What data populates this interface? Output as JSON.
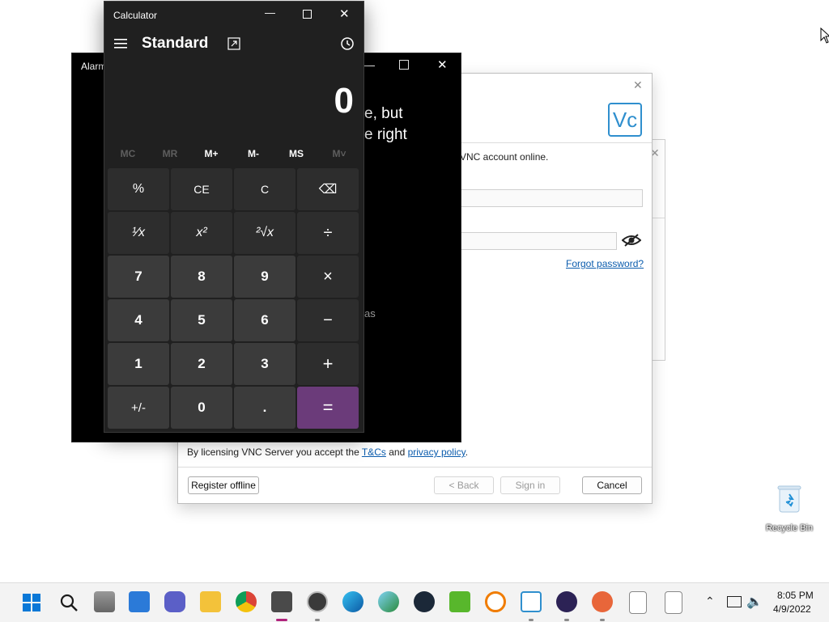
{
  "desktop": {
    "recycle_bin_label": "Recycle Bin"
  },
  "vnc_dialog": {
    "account_text": "VNC account online.",
    "forgot_password": "Forgot password?",
    "license_prefix": "By licensing VNC Server you accept the ",
    "tcs_link": "T&Cs",
    "and_text": " and ",
    "privacy_link": "privacy policy",
    "period": ".",
    "buttons": {
      "register_offline": "Register offline",
      "back": "< Back",
      "sign_in": "Sign in",
      "cancel": "Cancel"
    },
    "logo_text": "Vc"
  },
  "alarms_window": {
    "title": "Alarm",
    "text_line1": "e, but",
    "text_line2": "e right",
    "text_line3": "as"
  },
  "calculator": {
    "title": "Calculator",
    "mode": "Standard",
    "display": "0",
    "memory": [
      "MC",
      "MR",
      "M+",
      "M-",
      "MS",
      "M˅"
    ],
    "rows": [
      [
        "%",
        "CE",
        "C",
        "⌫"
      ],
      [
        "¹⁄x",
        "x²",
        "²√x",
        "÷"
      ],
      [
        "7",
        "8",
        "9",
        "×"
      ],
      [
        "4",
        "5",
        "6",
        "−"
      ],
      [
        "1",
        "2",
        "3",
        "+"
      ],
      [
        "+/-",
        "0",
        ".",
        "="
      ]
    ]
  },
  "taskbar": {
    "time": "8:05 PM",
    "date": "4/9/2022"
  }
}
